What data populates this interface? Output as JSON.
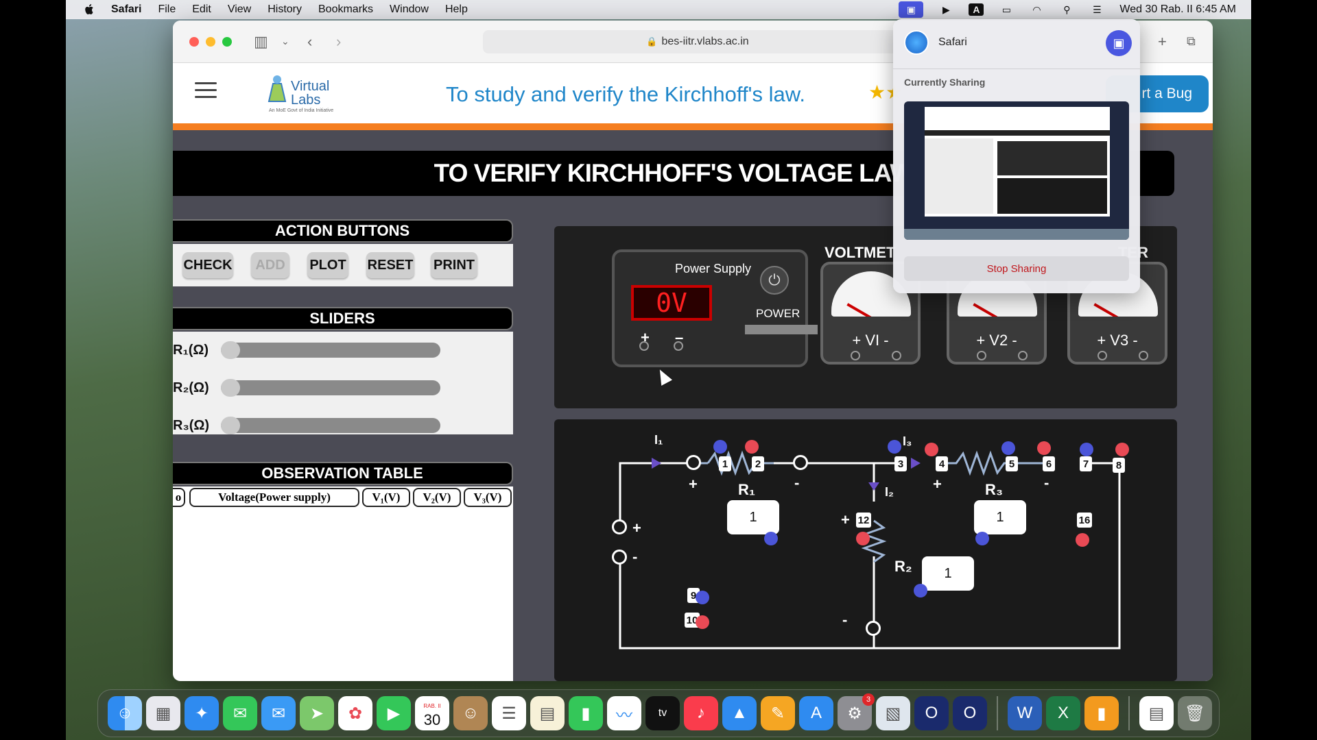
{
  "menubar": {
    "app": "Safari",
    "items": [
      "File",
      "Edit",
      "View",
      "History",
      "Bookmarks",
      "Window",
      "Help"
    ],
    "datetime": "Wed 30 Rab. II  6:45 AM"
  },
  "browser": {
    "url": "bes-iitr.vlabs.ac.in"
  },
  "page": {
    "logo_text": "Virtual Labs",
    "logo_sub": "An MoE Govt of India Initiative",
    "title": "To study and verify the Kirchhoff's law.",
    "report_bug": "Report a Bug",
    "bug_visible": "rt a Bug"
  },
  "sim": {
    "title": "TO VERIFY KIRCHHOFF'S VOLTAGE LAW",
    "action_head": "ACTION BUTTONS",
    "buttons": {
      "check": "CHECK",
      "add": "ADD",
      "plot": "PLOT",
      "reset": "RESET",
      "print": "PRINT"
    },
    "sliders_head": "SLIDERS",
    "sliders": [
      {
        "label": "R₁(Ω)",
        "value": 0
      },
      {
        "label": "R₂(Ω)",
        "value": 0
      },
      {
        "label": "R₃(Ω)",
        "value": 0
      }
    ],
    "observation_head": "OBSERVATION TABLE",
    "table_headers": [
      "o",
      "Voltage(Power supply)",
      "V₁(V)",
      "V₂(V)",
      "V₃(V)"
    ],
    "psu": {
      "title": "Power Supply",
      "display": "0V",
      "power_label": "POWER",
      "plus": "+",
      "minus": "–"
    },
    "voltmeter_label": "VOLTMET",
    "voltmeter_right": "TER",
    "meters": [
      "+ VI -",
      "+ V2 -",
      "+ V3 -"
    ],
    "circuit": {
      "I1": "I₁",
      "I2": "I₂",
      "I3": "I₃",
      "R1": "R₁",
      "R2": "R₂",
      "R3": "R₃",
      "box_values": [
        "1",
        "1",
        "1"
      ],
      "nodes": [
        "1",
        "2",
        "3",
        "4",
        "5",
        "6",
        "7",
        "8",
        "9",
        "10",
        "12",
        "16"
      ]
    }
  },
  "share_popover": {
    "app": "Safari",
    "subtitle": "Currently Sharing",
    "stop": "Stop Sharing"
  },
  "dock": {
    "calendar_month": "RAB. II",
    "calendar_day": "30",
    "settings_badge": "3"
  }
}
